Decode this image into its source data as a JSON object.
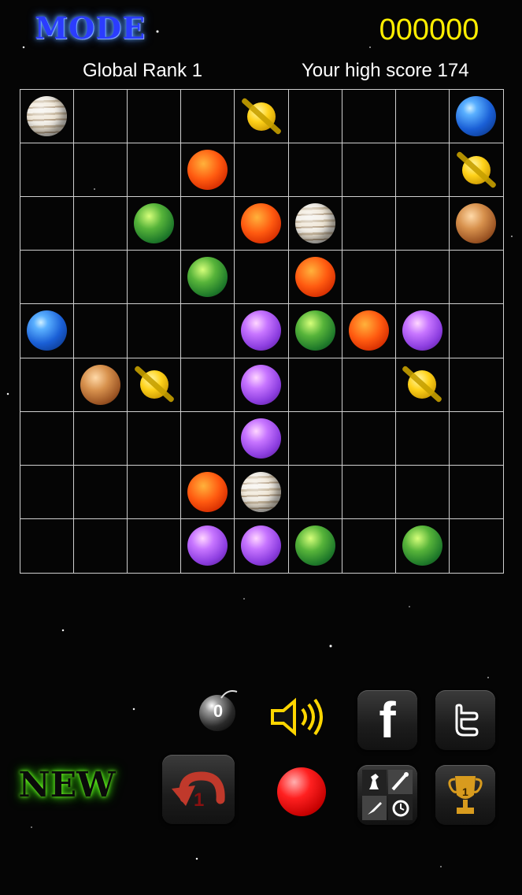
{
  "header": {
    "mode_label": "MODE",
    "score": "000000",
    "global_rank": "Global Rank 1",
    "high_score": "Your high score 174"
  },
  "board": {
    "rows": 9,
    "cols": 9,
    "cells": [
      [
        "jupiter",
        "",
        "",
        "",
        "saturn",
        "",
        "",
        "",
        "earth"
      ],
      [
        "",
        "",
        "",
        "sun",
        "",
        "",
        "",
        "",
        "saturn"
      ],
      [
        "",
        "",
        "green",
        "",
        "sun",
        "jupiter",
        "",
        "",
        "mars"
      ],
      [
        "",
        "",
        "",
        "green",
        "",
        "sun",
        "",
        "",
        ""
      ],
      [
        "earth",
        "",
        "",
        "",
        "purple",
        "green",
        "sun",
        "purple",
        ""
      ],
      [
        "",
        "mars",
        "saturn",
        "",
        "purple",
        "",
        "",
        "saturn",
        ""
      ],
      [
        "",
        "",
        "",
        "",
        "purple",
        "",
        "",
        "",
        ""
      ],
      [
        "",
        "",
        "",
        "sun",
        "jupiter",
        "",
        "",
        "",
        ""
      ],
      [
        "",
        "",
        "",
        "purple",
        "purple",
        "green",
        "",
        "green",
        ""
      ]
    ]
  },
  "controls": {
    "bomb_count": "0",
    "facebook_icon": "facebook-icon",
    "twitter_icon": "twitter-icon",
    "new_label": "NEW",
    "undo_count": "1",
    "next_ball_color": "#ff2020",
    "trophy_rank": "1"
  }
}
